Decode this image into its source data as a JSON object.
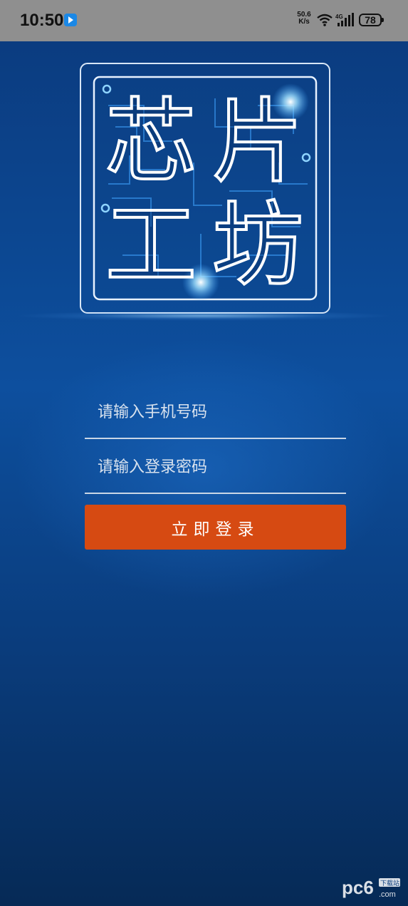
{
  "status_bar": {
    "time": "10:50",
    "net_speed_value": "50.6",
    "net_speed_unit": "K/s",
    "network_type": "4G",
    "battery": "78"
  },
  "login": {
    "logo_text": [
      "芯",
      "片",
      "工",
      "坊"
    ],
    "phone_placeholder": "请输入手机号码",
    "password_placeholder": "请输入登录密码",
    "login_button": "立即登录"
  },
  "watermark": {
    "text": "pc6",
    "sub": "下载站",
    "domain": ".com"
  },
  "colors": {
    "background_top": "#0b3c80",
    "background_bottom": "#062a56",
    "button": "#d64a12",
    "logo_stroke": "#ffffff",
    "circuit": "#3fa4ff"
  }
}
